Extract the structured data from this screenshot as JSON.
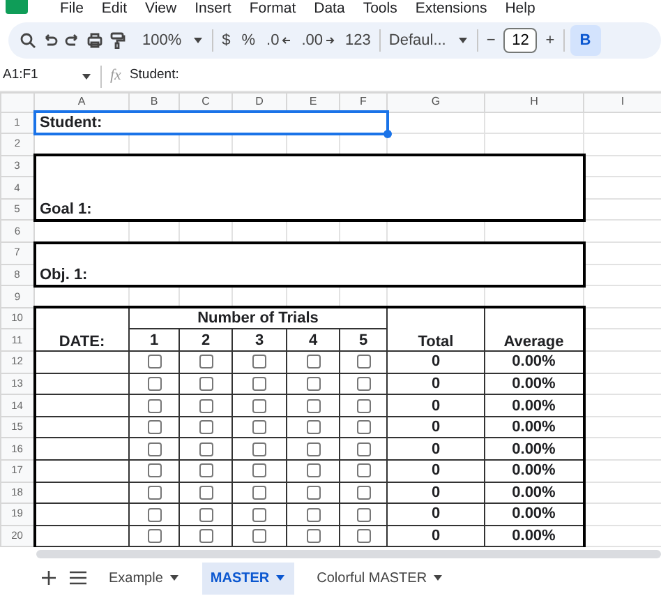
{
  "menu": [
    "File",
    "Edit",
    "View",
    "Insert",
    "Format",
    "Data",
    "Tools",
    "Extensions",
    "Help"
  ],
  "toolbar": {
    "zoom": "100%",
    "currency": "$",
    "percent": "%",
    "decrease_decimals": ".0",
    "increase_decimals": ".00",
    "number_format": "123",
    "font": "Defaul...",
    "font_size": "12",
    "minus": "−",
    "plus": "+",
    "bold": {
      "label": "B",
      "selected": true
    }
  },
  "formula_bar": {
    "cell_range": "A1:F1",
    "fx": "fx",
    "value": "Student:"
  },
  "columns": [
    "A",
    "B",
    "C",
    "D",
    "E",
    "F",
    "G",
    "H",
    "I"
  ],
  "rows": [
    "1",
    "2",
    "3",
    "4",
    "5",
    "6",
    "7",
    "8",
    "9",
    "10",
    "11",
    "12",
    "13",
    "14",
    "15",
    "16",
    "17",
    "18",
    "19",
    "20"
  ],
  "sheet": {
    "student_label": "Student:",
    "goal_label": "Goal 1:",
    "objective_label": "Obj. 1:",
    "trials_header": "Number of Trials",
    "date_header": "DATE:",
    "trial_numbers": [
      "1",
      "2",
      "3",
      "4",
      "5"
    ],
    "total_header": "Total",
    "average_header": "Average",
    "data_rows": [
      {
        "checks": [
          false,
          false,
          false,
          false,
          false
        ],
        "total": "0",
        "average": "0.00%"
      },
      {
        "checks": [
          false,
          false,
          false,
          false,
          false
        ],
        "total": "0",
        "average": "0.00%"
      },
      {
        "checks": [
          false,
          false,
          false,
          false,
          false
        ],
        "total": "0",
        "average": "0.00%"
      },
      {
        "checks": [
          false,
          false,
          false,
          false,
          false
        ],
        "total": "0",
        "average": "0.00%"
      },
      {
        "checks": [
          false,
          false,
          false,
          false,
          false
        ],
        "total": "0",
        "average": "0.00%"
      },
      {
        "checks": [
          false,
          false,
          false,
          false,
          false
        ],
        "total": "0",
        "average": "0.00%"
      },
      {
        "checks": [
          false,
          false,
          false,
          false,
          false
        ],
        "total": "0",
        "average": "0.00%"
      },
      {
        "checks": [
          false,
          false,
          false,
          false,
          false
        ],
        "total": "0",
        "average": "0.00%"
      },
      {
        "checks": [
          false,
          false,
          false,
          false,
          false
        ],
        "total": "0",
        "average": "0.00%"
      }
    ]
  },
  "sheet_tabs": [
    {
      "label": "Example",
      "selected": false
    },
    {
      "label": "MASTER",
      "selected": true
    },
    {
      "label": "Colorful MASTER",
      "selected": false
    }
  ]
}
